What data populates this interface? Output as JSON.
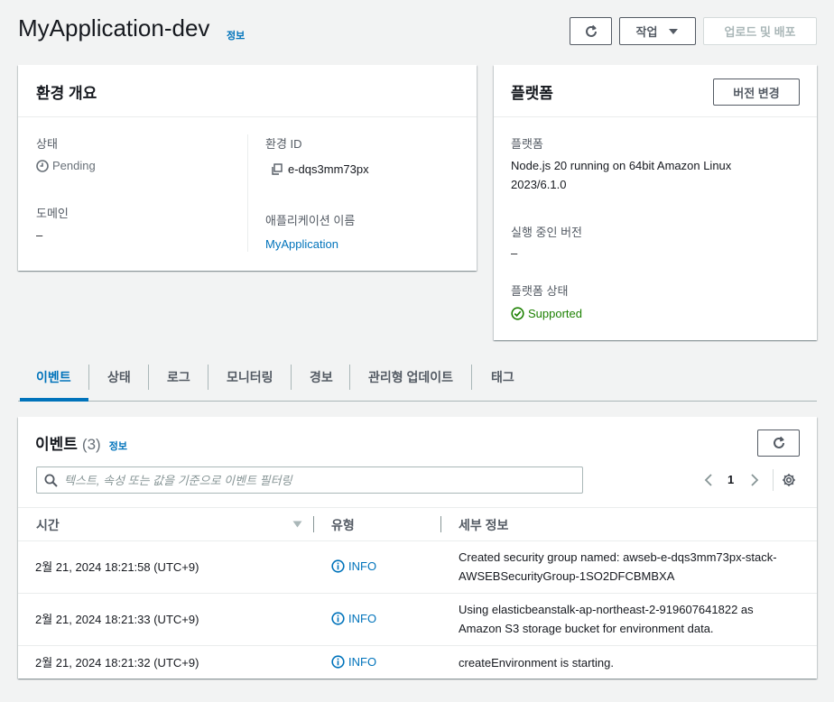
{
  "header": {
    "title": "MyApplication-dev",
    "info_link": "정보",
    "action_label": "작업",
    "deploy_label": "업로드 및 배포"
  },
  "overview": {
    "title": "환경 개요",
    "status_label": "상태",
    "status_value": "Pending",
    "domain_label": "도메인",
    "domain_value": "–",
    "env_id_label": "환경 ID",
    "env_id_value": "e-dqs3mm73px",
    "app_name_label": "애플리케이션 이름",
    "app_name_value": "MyApplication"
  },
  "platform": {
    "title": "플랫폼",
    "change_version_label": "버전 변경",
    "platform_label": "플랫폼",
    "platform_value_line1": "Node.js 20 running on 64bit Amazon Linux",
    "platform_value_line2": "2023/6.1.0",
    "running_version_label": "실행 중인 버전",
    "running_version_value": "–",
    "platform_status_label": "플랫폼 상태",
    "platform_status_value": "Supported"
  },
  "tabs": [
    {
      "label": "이벤트",
      "active": true
    },
    {
      "label": "상태",
      "active": false
    },
    {
      "label": "로그",
      "active": false
    },
    {
      "label": "모니터링",
      "active": false
    },
    {
      "label": "경보",
      "active": false
    },
    {
      "label": "관리형 업데이트",
      "active": false
    },
    {
      "label": "태그",
      "active": false
    }
  ],
  "events": {
    "title": "이벤트",
    "count": "(3)",
    "info_link": "정보",
    "search_placeholder": "텍스트, 속성 또는 값을 기준으로 이벤트 필터링",
    "page_number": "1",
    "columns": {
      "time": "시간",
      "type": "유형",
      "details": "세부 정보"
    },
    "rows": [
      {
        "time": "2월 21, 2024 18:21:58 (UTC+9)",
        "type": "INFO",
        "details_line1": "Created security group named: awseb-e-dqs3mm73px-stack-",
        "details_line2": "AWSEBSecurityGroup-1SO2DFCBMBXA"
      },
      {
        "time": "2월 21, 2024 18:21:33 (UTC+9)",
        "type": "INFO",
        "details_line1": "Using elasticbeanstalk-ap-northeast-2-919607641822 as",
        "details_line2": "Amazon S3 storage bucket for environment data."
      },
      {
        "time": "2월 21, 2024 18:21:32 (UTC+9)",
        "type": "INFO",
        "details_line1": "createEnvironment is starting.",
        "details_line2": ""
      }
    ]
  },
  "colors": {
    "link": "#0073bb",
    "success": "#1d8102",
    "background": "#f2f3f3",
    "border": "#545b64"
  },
  "icons": {
    "refresh": "refresh-icon",
    "caret": "caret-down-icon",
    "clock": "clock-icon",
    "copy": "copy-icon",
    "check": "check-circle-icon",
    "search": "search-icon",
    "info": "info-circle-icon",
    "settings": "gear-icon",
    "sort": "sort-down-icon",
    "prev": "chevron-left-icon",
    "next": "chevron-right-icon"
  }
}
